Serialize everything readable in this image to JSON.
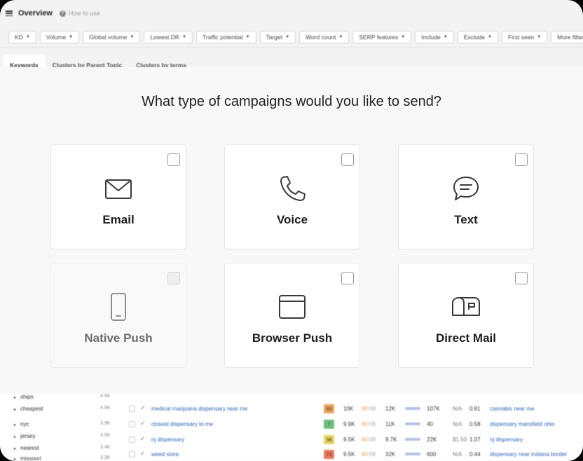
{
  "app": {
    "title": "Overview",
    "help_text": "How to use"
  },
  "filters": [
    "KD",
    "Volume",
    "Global volume",
    "Lowest DR",
    "Traffic potential",
    "Target",
    "Word count",
    "SERP features",
    "Include",
    "Exclude",
    "First seen",
    "More filters"
  ],
  "tabs": [
    "Keywords",
    "Clusters by Parent Topic",
    "Clusters by terms"
  ],
  "modal": {
    "question": "What type of campaigns would you like to send?",
    "options": [
      {
        "label": "Email",
        "icon": "envelope-icon",
        "enabled": true
      },
      {
        "label": "Voice",
        "icon": "phone-icon",
        "enabled": true
      },
      {
        "label": "Text",
        "icon": "chat-bubble-icon",
        "enabled": true
      },
      {
        "label": "Native Push",
        "icon": "smartphone-icon",
        "enabled": false
      },
      {
        "label": "Browser Push",
        "icon": "browser-window-icon",
        "enabled": true
      },
      {
        "label": "Direct Mail",
        "icon": "mailbox-icon",
        "enabled": true
      }
    ]
  },
  "table": {
    "left_terms": [
      {
        "term": "ships",
        "count": "4.6K"
      },
      {
        "term": "cheapest",
        "count": "4.5K"
      },
      {
        "term": "nyc",
        "count": "3.9K"
      },
      {
        "term": "jersey",
        "count": "3.5K"
      },
      {
        "term": "nearest",
        "count": "3.4K"
      },
      {
        "term": "missouri",
        "count": "3.3K"
      }
    ],
    "rows": [
      {
        "keyword": "medical marijuana dispensary near me",
        "kd": "69",
        "kd_color": "#f0a35a",
        "volume": "10K",
        "global": "12K",
        "traffic": "107K",
        "cpc": "N/A",
        "cps": "0.81",
        "parent": "cannabis near me"
      },
      {
        "keyword": "closest dispensary to me",
        "kd": "7",
        "kd_color": "#6cc27a",
        "volume": "9.9K",
        "global": "11K",
        "traffic": "40",
        "cpc": "N/A",
        "cps": "0.58",
        "parent": "dispensary mansfield ohio"
      },
      {
        "keyword": "nj dispensary",
        "kd": "38",
        "kd_color": "#e7d25a",
        "volume": "9.5K",
        "global": "9.7K",
        "traffic": "22K",
        "cpc": "$1.50",
        "cps": "1.07",
        "parent": "nj dispensary"
      },
      {
        "keyword": "weed store",
        "kd": "73",
        "kd_color": "#ec7a5a",
        "volume": "9.5K",
        "global": "32K",
        "traffic": "600",
        "cpc": "N/A",
        "cps": "0.44",
        "parent": "dispensary near indiana border"
      }
    ]
  }
}
